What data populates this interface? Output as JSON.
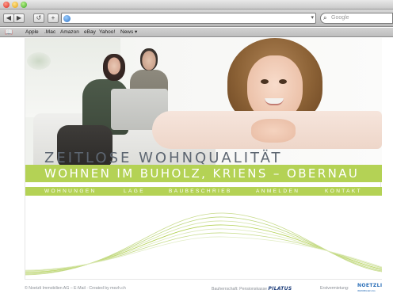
{
  "browser": {
    "nav": {
      "back": "◀",
      "forward": "▶",
      "reload": "↺",
      "add": "+"
    },
    "url": "",
    "search_placeholder": "Google",
    "bookmarks": [
      "Apple",
      ".Mac",
      "Amazon",
      "eBay",
      "Yahoo!",
      "News ▾"
    ]
  },
  "site": {
    "headline": "ZEITLOSE WOHNQUALITÄT",
    "subheadline": "WOHNEN IM BUHOLZ, KRIENS – OBERNAU",
    "nav": [
      "WOHNUNGEN",
      "LAGE",
      "BAUBESCHRIEB",
      "ANMELDEN",
      "KONTAKT"
    ],
    "accent_color": "#b4d255",
    "headline_color": "#5d6671"
  },
  "footer": {
    "left": "© Noetzli Immobilien AG – E-Mail · Created by mezh.ch",
    "client_label": "Bauherrschaft: Pensionskasse",
    "client_logo": "PILATUS",
    "agent_label": "Erstvermietung:",
    "agent_logo": "NOETZLI",
    "agent_logo_sub": "IMMOBILIEN AG"
  }
}
